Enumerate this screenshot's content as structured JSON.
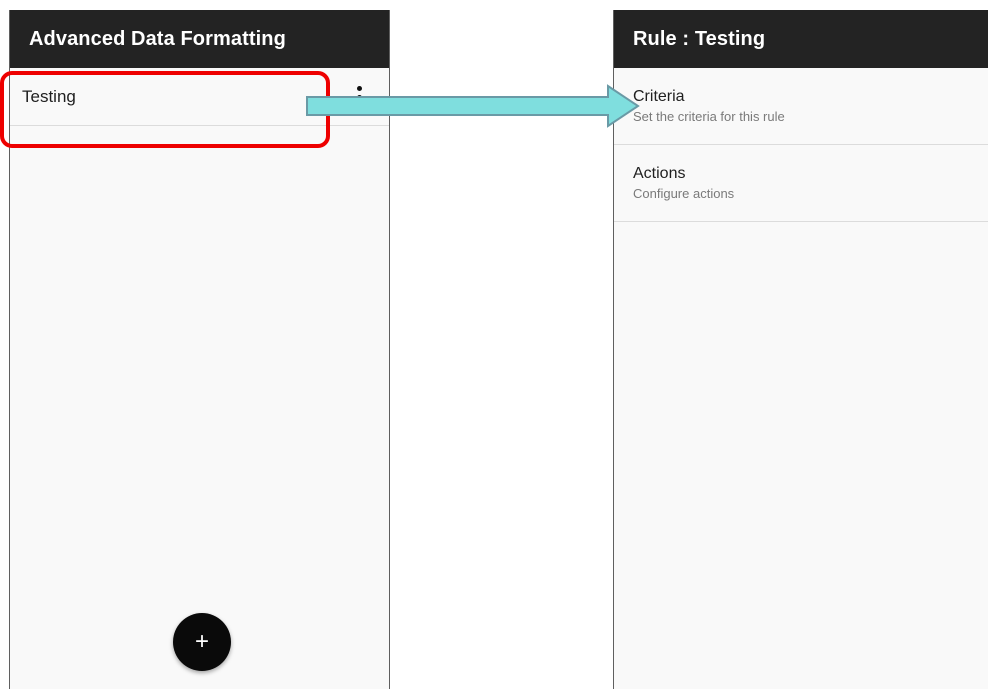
{
  "left_screen": {
    "title": "Advanced Data Formatting",
    "rules": [
      {
        "name": "Testing"
      }
    ],
    "overflow_icon": "more-vert-icon",
    "fab": {
      "icon": "plus-icon",
      "glyph": "+"
    }
  },
  "right_screen": {
    "title": "Rule : Testing",
    "items": [
      {
        "title": "Criteria",
        "summary": "Set the criteria for this rule"
      },
      {
        "title": "Actions",
        "summary": "Configure actions"
      }
    ]
  },
  "annotations": {
    "highlight_color": "#ee0000",
    "arrow_fill": "#7fdede",
    "arrow_stroke": "#6a9aa6"
  },
  "colors": {
    "appbar": "#232323",
    "screen_bg": "#f9f9f9"
  }
}
